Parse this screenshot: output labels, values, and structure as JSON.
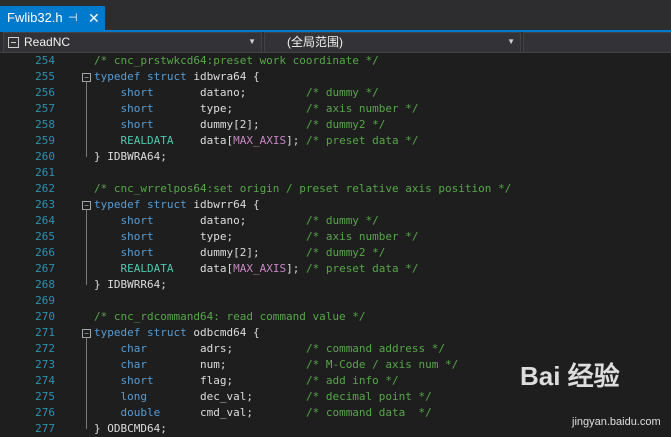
{
  "tab": {
    "title": "Fwlib32.h",
    "pin": "⊣",
    "close": "✕"
  },
  "navbar": {
    "project": "ReadNC",
    "scope": "(全局范围)",
    "member": ""
  },
  "lines": [
    {
      "n": "254",
      "segs": [
        {
          "t": "/* cnc_prstwkcd64:preset work coordinate */",
          "c": "cm"
        }
      ]
    },
    {
      "n": "255",
      "fold": true,
      "segs": [
        {
          "t": "typedef struct ",
          "c": "kw"
        },
        {
          "t": "idbwra64 {"
        }
      ]
    },
    {
      "n": "256",
      "segs": [
        {
          "t": "    "
        },
        {
          "t": "short",
          "c": "kw"
        },
        {
          "t": "       datano;         "
        },
        {
          "t": "/* dummy */",
          "c": "cm"
        }
      ]
    },
    {
      "n": "257",
      "segs": [
        {
          "t": "    "
        },
        {
          "t": "short",
          "c": "kw"
        },
        {
          "t": "       type;           "
        },
        {
          "t": "/* axis number */",
          "c": "cm"
        }
      ]
    },
    {
      "n": "258",
      "segs": [
        {
          "t": "    "
        },
        {
          "t": "short",
          "c": "kw"
        },
        {
          "t": "       dummy[2];       "
        },
        {
          "t": "/* dummy2 */",
          "c": "cm"
        }
      ]
    },
    {
      "n": "259",
      "segs": [
        {
          "t": "    "
        },
        {
          "t": "REALDATA",
          "c": "ty"
        },
        {
          "t": "    data["
        },
        {
          "t": "MAX_AXIS",
          "c": "mc"
        },
        {
          "t": "]; "
        },
        {
          "t": "/* preset data */",
          "c": "cm"
        }
      ]
    },
    {
      "n": "260",
      "segs": [
        {
          "t": "} IDBWRA64;"
        }
      ]
    },
    {
      "n": "261",
      "segs": []
    },
    {
      "n": "262",
      "segs": [
        {
          "t": "/* cnc_wrrelpos64:set origin / preset relative axis position */",
          "c": "cm"
        }
      ]
    },
    {
      "n": "263",
      "fold": true,
      "segs": [
        {
          "t": "typedef struct ",
          "c": "kw"
        },
        {
          "t": "idbwrr64 {"
        }
      ]
    },
    {
      "n": "264",
      "segs": [
        {
          "t": "    "
        },
        {
          "t": "short",
          "c": "kw"
        },
        {
          "t": "       datano;         "
        },
        {
          "t": "/* dummy */",
          "c": "cm"
        }
      ]
    },
    {
      "n": "265",
      "segs": [
        {
          "t": "    "
        },
        {
          "t": "short",
          "c": "kw"
        },
        {
          "t": "       type;           "
        },
        {
          "t": "/* axis number */",
          "c": "cm"
        }
      ]
    },
    {
      "n": "266",
      "segs": [
        {
          "t": "    "
        },
        {
          "t": "short",
          "c": "kw"
        },
        {
          "t": "       dummy[2];       "
        },
        {
          "t": "/* dummy2 */",
          "c": "cm"
        }
      ]
    },
    {
      "n": "267",
      "segs": [
        {
          "t": "    "
        },
        {
          "t": "REALDATA",
          "c": "ty"
        },
        {
          "t": "    data["
        },
        {
          "t": "MAX_AXIS",
          "c": "mc"
        },
        {
          "t": "]; "
        },
        {
          "t": "/* preset data */",
          "c": "cm"
        }
      ]
    },
    {
      "n": "268",
      "segs": [
        {
          "t": "} IDBWRR64;"
        }
      ]
    },
    {
      "n": "269",
      "segs": []
    },
    {
      "n": "270",
      "segs": [
        {
          "t": "/* cnc_rdcommand64: read command value */",
          "c": "cm"
        }
      ]
    },
    {
      "n": "271",
      "fold": true,
      "segs": [
        {
          "t": "typedef struct ",
          "c": "kw"
        },
        {
          "t": "odbcmd64 {"
        }
      ]
    },
    {
      "n": "272",
      "segs": [
        {
          "t": "    "
        },
        {
          "t": "char",
          "c": "kw"
        },
        {
          "t": "        adrs;           "
        },
        {
          "t": "/* command address */",
          "c": "cm"
        }
      ]
    },
    {
      "n": "273",
      "segs": [
        {
          "t": "    "
        },
        {
          "t": "char",
          "c": "kw"
        },
        {
          "t": "        num;            "
        },
        {
          "t": "/* M-Code / axis num */",
          "c": "cm"
        }
      ]
    },
    {
      "n": "274",
      "segs": [
        {
          "t": "    "
        },
        {
          "t": "short",
          "c": "kw"
        },
        {
          "t": "       flag;           "
        },
        {
          "t": "/* add info */",
          "c": "cm"
        }
      ]
    },
    {
      "n": "275",
      "segs": [
        {
          "t": "    "
        },
        {
          "t": "long",
          "c": "kw"
        },
        {
          "t": "        dec_val;        "
        },
        {
          "t": "/* decimal point */",
          "c": "cm"
        }
      ]
    },
    {
      "n": "276",
      "segs": [
        {
          "t": "    "
        },
        {
          "t": "double",
          "c": "kw"
        },
        {
          "t": "      cmd_val;        "
        },
        {
          "t": "/* command data  */",
          "c": "cm"
        }
      ]
    },
    {
      "n": "277",
      "segs": [
        {
          "t": "} ODBCMD64;"
        }
      ]
    }
  ],
  "watermark": {
    "text": "Bai 经验",
    "url": "jingyan.baidu.com"
  }
}
